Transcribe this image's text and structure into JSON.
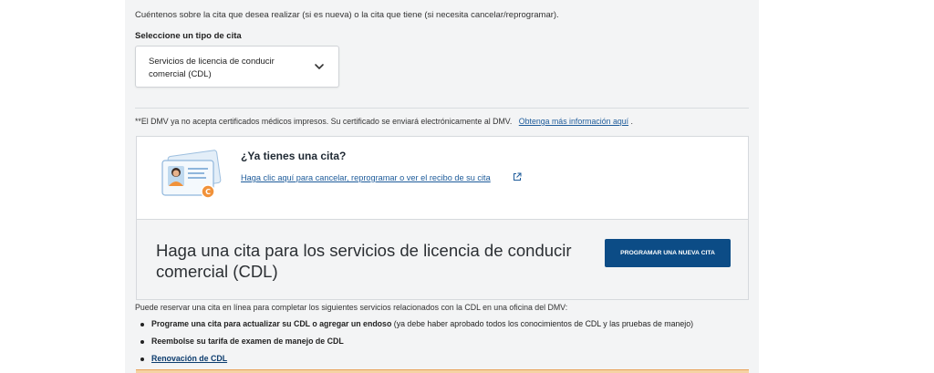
{
  "intro_text": "Cuéntenos sobre la cita que desea realizar (si es nueva) o la cita que tiene (si necesita cancelar/reprogramar).",
  "select": {
    "label": "Seleccione un tipo de cita",
    "value": "Servicios de licencia de conducir comercial (CDL)"
  },
  "notice": {
    "text": "**El DMV ya no acepta certificados médicos impresos. Su certificado se enviará electrónicamente al DMV.",
    "link": "Obtenga más información aquí",
    "suffix": "."
  },
  "existing": {
    "title": "¿Ya tienes una cita?",
    "link": "Haga clic aquí para cancelar, reprogramar o ver el recibo de su cita"
  },
  "schedule": {
    "heading": "Haga una cita para los servicios de licencia de conducir comercial (CDL)",
    "button": "PROGRAMAR UNA NUEVA CITA"
  },
  "reserve_text": "Puede reservar una cita en línea para completar los siguientes servicios relacionados con la CDL en una oficina del DMV:",
  "services": [
    {
      "bold": "Programe una cita para actualizar su CDL o agregar un endoso",
      "rest": " (ya debe haber aprobado todos los conocimientos de CDL y las pruebas de manejo)"
    },
    {
      "bold": "Reembolse su tarifa de examen de manejo de CDL",
      "rest": ""
    },
    {
      "link": "Renovación de CDL"
    }
  ],
  "colors": {
    "primary": "#0c4c86",
    "link": "#1d5b9a",
    "panel": "#f3f4f5"
  }
}
